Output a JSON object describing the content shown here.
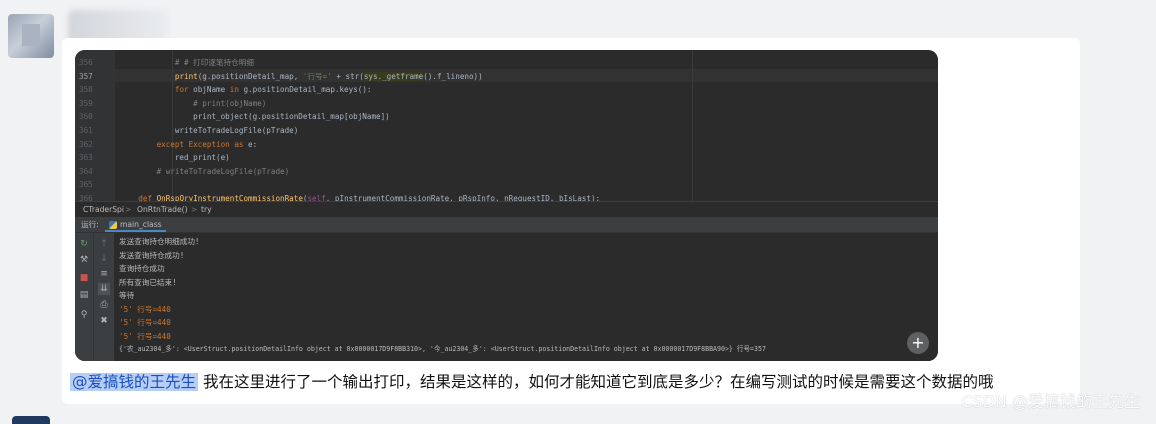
{
  "editor": {
    "lines": [
      {
        "num": "356",
        "segments": [
          {
            "t": "            ",
            "c": ""
          },
          {
            "t": "# # 打印逐笔持仓明细",
            "c": "c-com"
          }
        ]
      },
      {
        "num": "357",
        "current": true,
        "segments": [
          {
            "t": "            ",
            "c": ""
          },
          {
            "t": "print",
            "c": "c-fn"
          },
          {
            "t": "(g.positionDetail_map, ",
            "c": ""
          },
          {
            "t": "'行号='",
            "c": "c-str"
          },
          {
            "t": " + str(",
            "c": ""
          },
          {
            "t": "sys._getframe",
            "c": "c-hl"
          },
          {
            "t": "().f_lineno))",
            "c": ""
          }
        ]
      },
      {
        "num": "358",
        "segments": [
          {
            "t": "            ",
            "c": ""
          },
          {
            "t": "for",
            "c": "c-kw"
          },
          {
            "t": " objName ",
            "c": ""
          },
          {
            "t": "in",
            "c": "c-kw"
          },
          {
            "t": " g.positionDetail_map.keys():",
            "c": ""
          }
        ]
      },
      {
        "num": "359",
        "segments": [
          {
            "t": "                ",
            "c": ""
          },
          {
            "t": "# print(objName)",
            "c": "c-com"
          }
        ]
      },
      {
        "num": "360",
        "segments": [
          {
            "t": "                print_object(g.positionDetail_map[objName])",
            "c": ""
          }
        ]
      },
      {
        "num": "361",
        "segments": [
          {
            "t": "            writeToTradeLogFile(pTrade)",
            "c": ""
          }
        ]
      },
      {
        "num": "362",
        "segments": [
          {
            "t": "        ",
            "c": ""
          },
          {
            "t": "except",
            "c": "c-kw"
          },
          {
            "t": " ",
            "c": ""
          },
          {
            "t": "Exception",
            "c": "c-kw"
          },
          {
            "t": " ",
            "c": ""
          },
          {
            "t": "as",
            "c": "c-kw"
          },
          {
            "t": " e:",
            "c": ""
          }
        ]
      },
      {
        "num": "363",
        "segments": [
          {
            "t": "            red_print(e)",
            "c": ""
          }
        ]
      },
      {
        "num": "364",
        "segments": [
          {
            "t": "        ",
            "c": ""
          },
          {
            "t": "# writeToTradeLogFile(pTrade)",
            "c": "c-com"
          }
        ]
      },
      {
        "num": "365",
        "segments": [
          {
            "t": "",
            "c": ""
          }
        ]
      },
      {
        "num": "366",
        "segments": [
          {
            "t": "    ",
            "c": ""
          },
          {
            "t": "def",
            "c": "c-kw"
          },
          {
            "t": " ",
            "c": ""
          },
          {
            "t": "OnRspQryInstrumentCommissionRate",
            "c": "c-fn"
          },
          {
            "t": "(",
            "c": ""
          },
          {
            "t": "self",
            "c": "c-self"
          },
          {
            "t": ", pInstrumentCommissionRate, pRspInfo, nRequestID, bIsLast):",
            "c": ""
          }
        ]
      }
    ]
  },
  "breadcrumb": {
    "items": [
      "CTraderSpi",
      "OnRtnTrade()",
      "try"
    ],
    "separator": ">"
  },
  "run": {
    "label": "运行:",
    "tab": "main_class"
  },
  "output": [
    "发送查询持仓明细成功!",
    "发送查询持仓成功!",
    "查询持仓成功",
    "所有查询已结束!",
    "等待",
    "'5' 行号=440",
    "'5' 行号=440",
    "'5' 行号=440",
    "{'农_au2304_多': <UserStruct.positionDetailInfo object at 0x0000017D9F8BB310>, '今_au2304_多': <UserStruct.positionDetailInfo object at 0x0000017D9F8BBA90>} 行号=357"
  ],
  "caption": {
    "mention": "@爱搞钱的王先生",
    "text": "我在这里进行了一个输出打印，结果是这样的，如何才能知道它到底是多少？在编写测试的时候是需要这个数据的哦"
  },
  "watermark": "CSDN @爱搞钱的王先生",
  "plus_label": "+"
}
